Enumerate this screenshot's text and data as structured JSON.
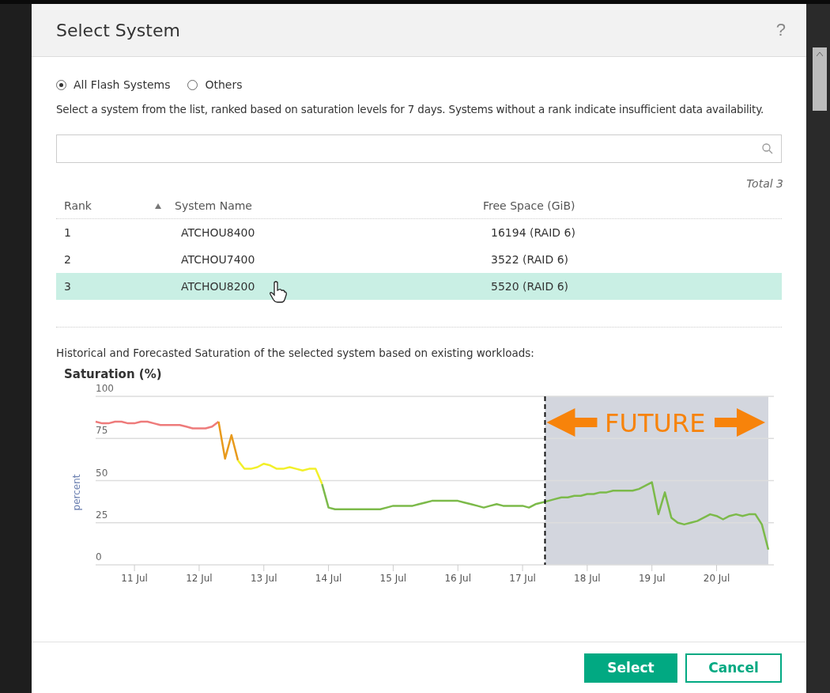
{
  "dialog": {
    "title": "Select System",
    "help": "?"
  },
  "filters": [
    {
      "label": "All Flash Systems",
      "selected": true
    },
    {
      "label": "Others",
      "selected": false
    }
  ],
  "description": "Select a system from the list, ranked based on saturation levels for 7 days. Systems without a rank indicate insufficient data availability.",
  "total": "Total 3",
  "table": {
    "columns": [
      {
        "label": "Rank",
        "sorted": true
      },
      {
        "label": "System Name",
        "sorted": false
      },
      {
        "label": "Free Space (GiB)",
        "sorted": false
      }
    ],
    "rows": [
      {
        "cells": [
          "1",
          "ATCHOU8400",
          "16194 (RAID 6)"
        ],
        "selected": false
      },
      {
        "cells": [
          "2",
          "ATCHOU7400",
          "3522 (RAID 6)"
        ],
        "selected": false
      },
      {
        "cells": [
          "3",
          "ATCHOU8200",
          "5520 (RAID 6)"
        ],
        "selected": true
      }
    ]
  },
  "caption": "Historical and Forecasted Saturation of the selected system based on existing workloads:",
  "chart": {
    "chart_data": {
      "type": "line",
      "title": "Saturation (%)",
      "ylabel": "percent",
      "categories": [
        null,
        null,
        null,
        null,
        null,
        null,
        "11 Jul",
        null,
        null,
        null,
        null,
        null,
        null,
        null,
        null,
        null,
        "12 Jul",
        null,
        null,
        null,
        null,
        null,
        null,
        null,
        null,
        null,
        "13 Jul",
        null,
        null,
        null,
        null,
        null,
        null,
        null,
        null,
        null,
        "14 Jul",
        null,
        null,
        null,
        null,
        null,
        null,
        null,
        null,
        null,
        "15 Jul",
        null,
        null,
        null,
        null,
        null,
        null,
        null,
        null,
        null,
        "16 Jul",
        null,
        null,
        null,
        null,
        null,
        null,
        null,
        null,
        null,
        "17 Jul",
        null,
        null,
        null,
        null,
        null,
        null,
        null,
        null,
        null,
        "18 Jul",
        null,
        null,
        null,
        null,
        null,
        null,
        null,
        null,
        null,
        "19 Jul",
        null,
        null,
        null,
        null,
        null,
        null,
        null,
        null,
        null,
        "20 Jul",
        null,
        null,
        null,
        null,
        null,
        null,
        null,
        null
      ],
      "series": [
        {
          "color": "#ee7b7b",
          "values": [
            85,
            84,
            84,
            85,
            85,
            84,
            84,
            85,
            85,
            84,
            83,
            83,
            83,
            83,
            82,
            81,
            81,
            81,
            82,
            85,
            null,
            null,
            null,
            null,
            null,
            null,
            null,
            null,
            null,
            null,
            null,
            null,
            null,
            null,
            null,
            null,
            null,
            null,
            null,
            null,
            null,
            null,
            null,
            null,
            null,
            null,
            null,
            null,
            null,
            null,
            null,
            null,
            null,
            null,
            null,
            null,
            null,
            null,
            null,
            null,
            null,
            null,
            null,
            null,
            null,
            null,
            null,
            null,
            null,
            null,
            null,
            null,
            null,
            null,
            null,
            null,
            null,
            null,
            null,
            null,
            null,
            null,
            null,
            null,
            null,
            null,
            null,
            null,
            null,
            null,
            null,
            null,
            null,
            null,
            null,
            null,
            null,
            null,
            null,
            null,
            null,
            null,
            null,
            null,
            null
          ]
        },
        {
          "color": "#e89a1c",
          "values": [
            null,
            null,
            null,
            null,
            null,
            null,
            null,
            null,
            null,
            null,
            null,
            null,
            null,
            null,
            null,
            null,
            null,
            null,
            null,
            85,
            63,
            77,
            62,
            null,
            null,
            null,
            null,
            null,
            null,
            null,
            null,
            null,
            null,
            null,
            null,
            null,
            null,
            null,
            null,
            null,
            null,
            null,
            null,
            null,
            null,
            null,
            null,
            null,
            null,
            null,
            null,
            null,
            null,
            null,
            null,
            null,
            null,
            null,
            null,
            null,
            null,
            null,
            null,
            null,
            null,
            null,
            null,
            null,
            null,
            null,
            null,
            null,
            null,
            null,
            null,
            null,
            null,
            null,
            null,
            null,
            null,
            null,
            null,
            null,
            null,
            null,
            null,
            null,
            null,
            null,
            null,
            null,
            null,
            null,
            null,
            null,
            null,
            null,
            null,
            null,
            null,
            null,
            null,
            null,
            null
          ]
        },
        {
          "color": "#f2f02a",
          "values": [
            null,
            null,
            null,
            null,
            null,
            null,
            null,
            null,
            null,
            null,
            null,
            null,
            null,
            null,
            null,
            null,
            null,
            null,
            null,
            null,
            null,
            null,
            62,
            57,
            57,
            58,
            60,
            59,
            57,
            57,
            58,
            57,
            56,
            57,
            57,
            48,
            null,
            null,
            null,
            null,
            null,
            null,
            null,
            null,
            null,
            null,
            null,
            null,
            null,
            null,
            null,
            null,
            null,
            null,
            null,
            null,
            null,
            null,
            null,
            null,
            null,
            null,
            null,
            null,
            null,
            null,
            null,
            null,
            null,
            null,
            null,
            null,
            null,
            null,
            null,
            null,
            null,
            null,
            null,
            null,
            null,
            null,
            null,
            null,
            null,
            null,
            null,
            null,
            null,
            null,
            null,
            null,
            null,
            null,
            null,
            null,
            null,
            null,
            null,
            null,
            null,
            null,
            null,
            null,
            null
          ]
        },
        {
          "color": "#7cba4a",
          "values": [
            null,
            null,
            null,
            null,
            null,
            null,
            null,
            null,
            null,
            null,
            null,
            null,
            null,
            null,
            null,
            null,
            null,
            null,
            null,
            null,
            null,
            null,
            null,
            null,
            null,
            null,
            null,
            null,
            null,
            null,
            null,
            null,
            null,
            null,
            null,
            48,
            34,
            33,
            33,
            33,
            33,
            33,
            33,
            33,
            33,
            34,
            35,
            35,
            35,
            35,
            36,
            37,
            38,
            38,
            38,
            38,
            38,
            37,
            36,
            35,
            34,
            35,
            36,
            35,
            35,
            35,
            35,
            34,
            36,
            37,
            38,
            39,
            40,
            40,
            41,
            41,
            42,
            42,
            43,
            43,
            44,
            44,
            44,
            44,
            45,
            47,
            49,
            30,
            43,
            28,
            25,
            24,
            25,
            26,
            28,
            30,
            29,
            27,
            29,
            30,
            29,
            30,
            30,
            24,
            9
          ]
        }
      ],
      "ylim": [
        0,
        100
      ],
      "yticks": [
        0,
        25,
        50,
        75,
        100
      ],
      "grid": true
    },
    "forecast": {
      "label": "FUTURE"
    }
  },
  "buttons": [
    {
      "label": "Select",
      "kind": "primary"
    },
    {
      "label": "Cancel",
      "kind": "secondary"
    }
  ]
}
